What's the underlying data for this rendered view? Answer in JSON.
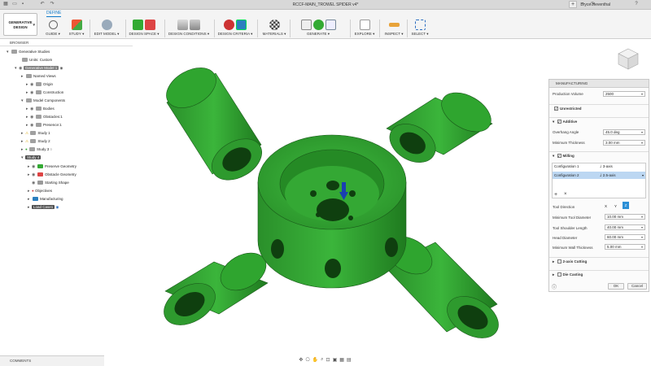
{
  "titlebar": {
    "title": "RCCF-MAIN_TROWEL SPIDER v4*",
    "user": "Bryce Heventhal"
  },
  "ribbon": {
    "workspace": "GENERATIVE DESIGN",
    "active_tab": "DEFINE",
    "groups": [
      {
        "label": "GUIDE ▾"
      },
      {
        "label": "STUDY ▾"
      },
      {
        "label": "EDIT MODEL ▾"
      },
      {
        "label": "DESIGN SPACE ▾"
      },
      {
        "label": "DESIGN CONDITIONS ▾"
      },
      {
        "label": "DESIGN CRITERIA ▾"
      },
      {
        "label": "MATERIALS ▾"
      },
      {
        "label": "GENERATE ▾"
      },
      {
        "label": "EXPLORE ▾"
      },
      {
        "label": "INSPECT ▾"
      },
      {
        "label": "SELECT ▾"
      }
    ]
  },
  "browser": {
    "header": "BROWSER",
    "items": [
      {
        "label": "Generative Studies"
      },
      {
        "label": "Units: Custom"
      },
      {
        "label": "Generative Model 1"
      },
      {
        "label": "Named Views"
      },
      {
        "label": "Origin"
      },
      {
        "label": "Construction"
      },
      {
        "label": "Model Components"
      },
      {
        "label": "Bodies"
      },
      {
        "label": "Obstacles:1"
      },
      {
        "label": "Presence:1"
      },
      {
        "label": "Study 1"
      },
      {
        "label": "Study 2"
      },
      {
        "label": "Study 3"
      },
      {
        "label": "Study 4"
      },
      {
        "label": "Preserve Geometry"
      },
      {
        "label": "Obstacle Geometry"
      },
      {
        "label": "Starting Shape"
      },
      {
        "label": "Objectives"
      },
      {
        "label": "Manufacturing"
      },
      {
        "label": "Load Case1"
      }
    ]
  },
  "panel": {
    "title": "MANUFACTURING",
    "production_volume_label": "Production Volume",
    "production_volume_value": "2500",
    "unrestricted_label": "Unrestricted",
    "additive_label": "Additive",
    "overhang_label": "Overhang Angle",
    "overhang_value": "45.0 deg",
    "min_thickness_label": "Minimum Thickness",
    "min_thickness_value": "3.00 mm",
    "milling_label": "Milling",
    "config1_label": "Configuration 1",
    "config1_value": "3-axis",
    "config2_label": "Configuration 2",
    "config2_value": "2.5-axis",
    "add_label": "+",
    "remove_label": "×",
    "tool_direction_label": "Tool Direction",
    "tool_dir_x": "X",
    "tool_dir_y": "Y",
    "tool_dir_z": "Z",
    "min_tool_diameter_label": "Minimum Tool Diameter",
    "min_tool_diameter_value": "10.00 mm",
    "tool_shoulder_label": "Tool Shoulder Length",
    "tool_shoulder_value": "40.00 mm",
    "head_diameter_label": "Head Diameter",
    "head_diameter_value": "60.00 mm",
    "min_wall_label": "Minimum Wall Thickness",
    "min_wall_value": "5.00 mm",
    "two_axis_label": "2-axis Cutting",
    "die_casting_label": "Die Casting",
    "ok_label": "OK",
    "cancel_label": "Cancel"
  },
  "comments": {
    "label": "COMMENTS"
  },
  "colors": {
    "model_green": "#2f9d2f",
    "accent_blue": "#0d78c8",
    "arrow_blue": "#1a3fb0"
  }
}
